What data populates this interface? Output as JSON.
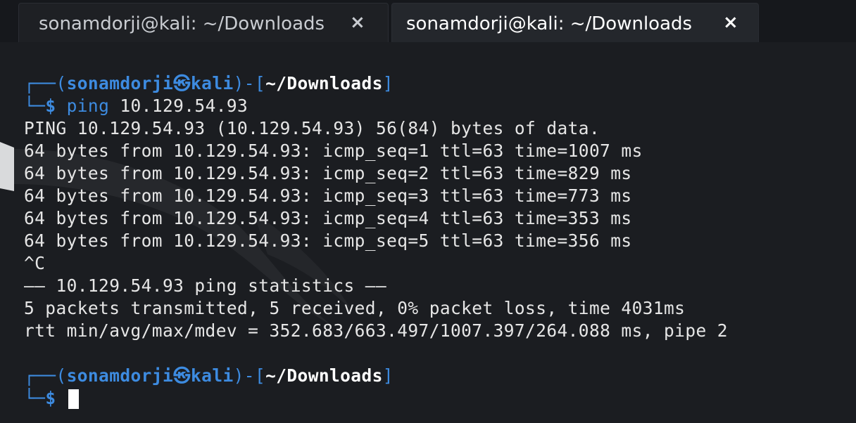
{
  "tabs": [
    {
      "label": "sonamdorji@kali: ~/Downloads",
      "close": "×"
    },
    {
      "label": "sonamdorji@kali: ~/Downloads",
      "close": "×"
    }
  ],
  "prompt1": {
    "box_top": "┌──(",
    "user": "sonamdorji",
    "at": "㉿",
    "host": "kali",
    "mid": ")-[",
    "dir": "~/Downloads",
    "end": "]",
    "box_bottom": "└─",
    "dollar": "$",
    "command": "ping",
    "args": " 10.129.54.93"
  },
  "output": [
    "PING 10.129.54.93 (10.129.54.93) 56(84) bytes of data.",
    "64 bytes from 10.129.54.93: icmp_seq=1 ttl=63 time=1007 ms",
    "64 bytes from 10.129.54.93: icmp_seq=2 ttl=63 time=829 ms",
    "64 bytes from 10.129.54.93: icmp_seq=3 ttl=63 time=773 ms",
    "64 bytes from 10.129.54.93: icmp_seq=4 ttl=63 time=353 ms",
    "64 bytes from 10.129.54.93: icmp_seq=5 ttl=63 time=356 ms",
    "^C",
    "—— 10.129.54.93 ping statistics ——",
    "5 packets transmitted, 5 received, 0% packet loss, time 4031ms",
    "rtt min/avg/max/mdev = 352.683/663.497/1007.397/264.088 ms, pipe 2"
  ],
  "prompt2": {
    "box_top": "┌──(",
    "user": "sonamdorji",
    "at": "㉿",
    "host": "kali",
    "mid": ")-[",
    "dir": "~/Downloads",
    "end": "]",
    "box_bottom": "└─",
    "dollar": "$"
  },
  "colors": {
    "background": "#1b1d21",
    "prompt_blue": "#3d8be0",
    "text": "#e6e6e6"
  }
}
